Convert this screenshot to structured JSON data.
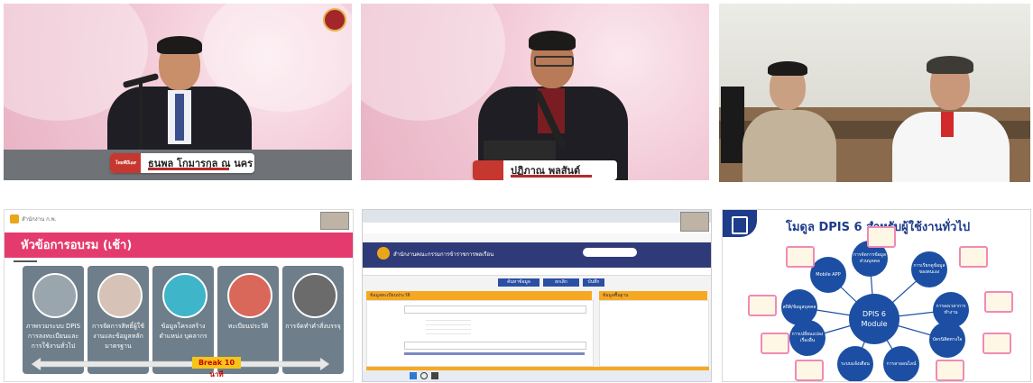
{
  "tile1": {
    "name": "ธนพล โกมารกุล ณ นคร",
    "logo": "ไทยพีบีเอส"
  },
  "tile2": {
    "name": "ปฏิภาณ พลสันต์"
  },
  "tile4": {
    "title": "หัวข้อการอบรม (เช้า)",
    "header_label": "สำนักงาน ก.พ.",
    "cards": [
      "ภาพรวมระบบ DPIS การลงทะเบียนและการใช้งานทั่วไป",
      "การจัดการสิทธิ์ผู้ใช้งานและข้อมูลหลักมาตรฐาน",
      "ข้อมูลโครงสร้าง ตำแหน่ง บุคลากร",
      "ทะเบียนประวัติ",
      "การจัดทำคำสั่งบรรจุ"
    ],
    "break_label": "Break 10 นาที"
  },
  "tile5": {
    "app_title": "สำนักงานคณะกรรมการข้าราชการพลเรือน",
    "section_left": "ข้อมูลทะเบียนประวัติ",
    "section_right": "ข้อมูลพื้นฐาน",
    "buttons": [
      "ค้นหาข้อมูล",
      "ยกเลิก",
      "บันทึก"
    ]
  },
  "tile6": {
    "title": "โมดูล DPIS 6 สำหรับผู้ใช้งานทั่วไป",
    "hub": "DPIS 6 Module",
    "nodes": [
      "การจัดการข้อมูลส่วนบุคคล",
      "การเรียกดูข้อมูลของตนเอง",
      "การลงเวลาการทำงาน",
      "บัตรนิสิตทางใจ",
      "การลาออนไลน์",
      "ระบบแจ้งเตือน",
      "การเปลี่ยนแปลงเรื่องอื่น",
      "สถิติ/ข้อมูลบุคคล",
      "Mobile APP"
    ]
  },
  "colors": {
    "accent_pink": "#e43b6e",
    "dpis_blue": "#1c4fa3",
    "break_yellow": "#f5c518"
  }
}
